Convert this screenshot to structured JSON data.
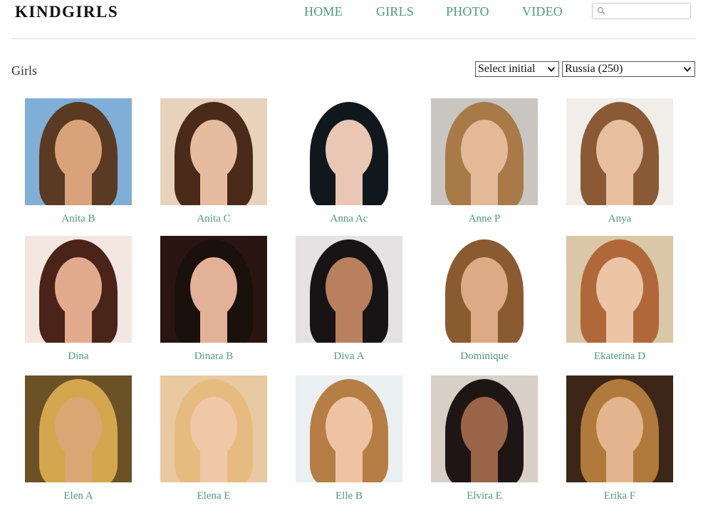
{
  "header": {
    "logo": "KINDGIRLS",
    "nav": [
      "HOME",
      "GIRLS",
      "PHOTO",
      "VIDEO"
    ],
    "search": {
      "placeholder": "",
      "value": ""
    }
  },
  "page": {
    "title": "Girls",
    "initial_select": "Select initial",
    "country_select": "Russia (250)"
  },
  "colors": {
    "link": "#4d9a7a",
    "rule": "#dcdcdc"
  },
  "girls": [
    {
      "name": "Anita B",
      "bg": "#7faed6",
      "hair": "#5a3a22",
      "skin": "#d8a27a"
    },
    {
      "name": "Anita C",
      "bg": "#e8d2bc",
      "hair": "#4a2a18",
      "skin": "#e6bca0"
    },
    {
      "name": "Anna Ac",
      "bg": "#ffffff",
      "hair": "#10181e",
      "skin": "#e9c7b4"
    },
    {
      "name": "Anne P",
      "bg": "#c9c6c2",
      "hair": "#a77a48",
      "skin": "#e3b998"
    },
    {
      "name": "Anya",
      "bg": "#f1ede8",
      "hair": "#8a5a36",
      "skin": "#e8bf9e"
    },
    {
      "name": "Dina",
      "bg": "#f3e6e0",
      "hair": "#4a2418",
      "skin": "#e2ab8e"
    },
    {
      "name": "Dinara B",
      "bg": "#2a1412",
      "hair": "#1a100c",
      "skin": "#e2b198"
    },
    {
      "name": "Diva A",
      "bg": "#e4e2e2",
      "hair": "#161414",
      "skin": "#b8805c"
    },
    {
      "name": "Dominique",
      "bg": "#ffffff",
      "hair": "#8a5a30",
      "skin": "#dcaa84"
    },
    {
      "name": "Ekaterina D",
      "bg": "#d9c7a8",
      "hair": "#b0683a",
      "skin": "#ecc4a6"
    },
    {
      "name": "Elen A",
      "bg": "#6a5226",
      "hair": "#d4a64e",
      "skin": "#d9a674"
    },
    {
      "name": "Elena E",
      "bg": "#e9c9a2",
      "hair": "#e6bb80",
      "skin": "#f0c8a8"
    },
    {
      "name": "Elle B",
      "bg": "#eaf0f2",
      "hair": "#b67e44",
      "skin": "#eec3a4"
    },
    {
      "name": "Elvira E",
      "bg": "#d8d0c8",
      "hair": "#1e1614",
      "skin": "#9a6448"
    },
    {
      "name": "Erika F",
      "bg": "#3c2618",
      "hair": "#b07a3c",
      "skin": "#e4b48e"
    }
  ]
}
